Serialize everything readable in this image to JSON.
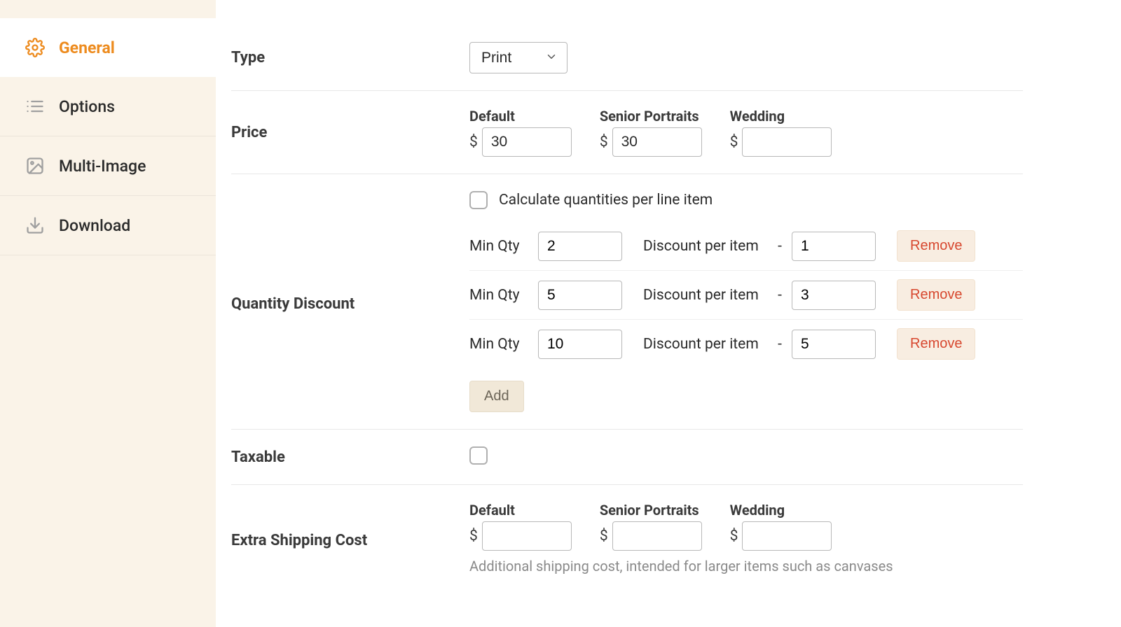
{
  "sidebar": {
    "items": [
      {
        "label": "General"
      },
      {
        "label": "Options"
      },
      {
        "label": "Multi-Image"
      },
      {
        "label": "Download"
      }
    ]
  },
  "form": {
    "type": {
      "label": "Type",
      "value": "Print"
    },
    "price": {
      "label": "Price",
      "columns": [
        {
          "label": "Default",
          "value": "30"
        },
        {
          "label": "Senior Portraits",
          "value": "30"
        },
        {
          "label": "Wedding",
          "value": ""
        }
      ],
      "currency_symbol": "$"
    },
    "quantity_discount": {
      "label": "Quantity Discount",
      "checkbox_label": "Calculate quantities per line item",
      "checkbox_checked": false,
      "min_qty_label": "Min Qty",
      "discount_label": "Discount per item",
      "minus_symbol": "-",
      "rows": [
        {
          "min_qty": "2",
          "discount": "1"
        },
        {
          "min_qty": "5",
          "discount": "3"
        },
        {
          "min_qty": "10",
          "discount": "5"
        }
      ],
      "remove_label": "Remove",
      "add_label": "Add"
    },
    "taxable": {
      "label": "Taxable",
      "checked": false
    },
    "extra_shipping": {
      "label": "Extra Shipping Cost",
      "columns": [
        {
          "label": "Default",
          "value": ""
        },
        {
          "label": "Senior Portraits",
          "value": ""
        },
        {
          "label": "Wedding",
          "value": ""
        }
      ],
      "currency_symbol": "$",
      "help": "Additional shipping cost, intended for larger items such as canvases"
    }
  }
}
